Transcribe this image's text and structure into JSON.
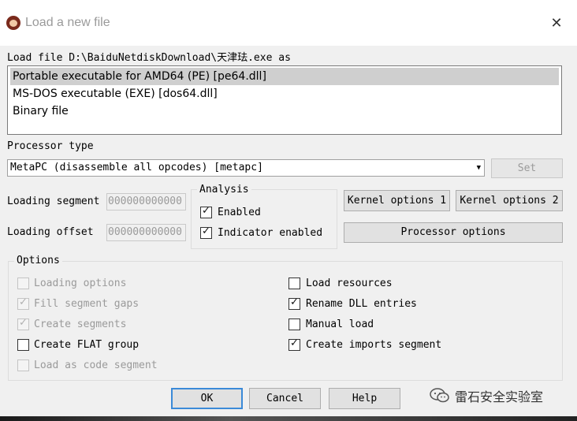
{
  "window": {
    "title": "Load a new file",
    "close_glyph": "✕"
  },
  "load_file_label": "Load file D:\\BaiduNetdiskDownload\\天津珐.exe as",
  "file_types": [
    {
      "label": "Portable executable for AMD64 (PE) [pe64.dll]",
      "selected": true
    },
    {
      "label": "MS-DOS executable (EXE) [dos64.dll]",
      "selected": false
    },
    {
      "label": "Binary file",
      "selected": false
    }
  ],
  "processor": {
    "label": "Processor type",
    "selected": "MetaPC (disassemble all opcodes) [metapc]",
    "set_button": "Set"
  },
  "loading": {
    "segment_label": "Loading segment",
    "segment_value": "000000000000",
    "offset_label": "Loading offset",
    "offset_value": "000000000000"
  },
  "analysis": {
    "title": "Analysis",
    "enabled_label": "Enabled",
    "enabled_checked": true,
    "indicator_label": "Indicator enabled",
    "indicator_checked": true
  },
  "buttons": {
    "kernel1": "Kernel options 1",
    "kernel2": "Kernel options 2",
    "processor_options": "Processor options",
    "ok": "OK",
    "cancel": "Cancel",
    "help": "Help"
  },
  "options": {
    "title": "Options",
    "left": [
      {
        "label": "Loading options",
        "checked": false,
        "disabled": true
      },
      {
        "label": "Fill segment gaps",
        "checked": true,
        "disabled": true
      },
      {
        "label": "Create segments",
        "checked": true,
        "disabled": true
      },
      {
        "label": "Create FLAT group",
        "checked": false,
        "disabled": false
      },
      {
        "label": "Load as code segment",
        "checked": false,
        "disabled": true
      }
    ],
    "right": [
      {
        "label": "Load resources",
        "checked": false,
        "disabled": false
      },
      {
        "label": "Rename DLL entries",
        "checked": true,
        "disabled": false
      },
      {
        "label": "Manual load",
        "checked": false,
        "disabled": false
      },
      {
        "label": "Create imports segment",
        "checked": true,
        "disabled": false
      }
    ]
  },
  "watermark": {
    "text": "雷石安全实验室",
    "icon": "wechat-icon"
  }
}
